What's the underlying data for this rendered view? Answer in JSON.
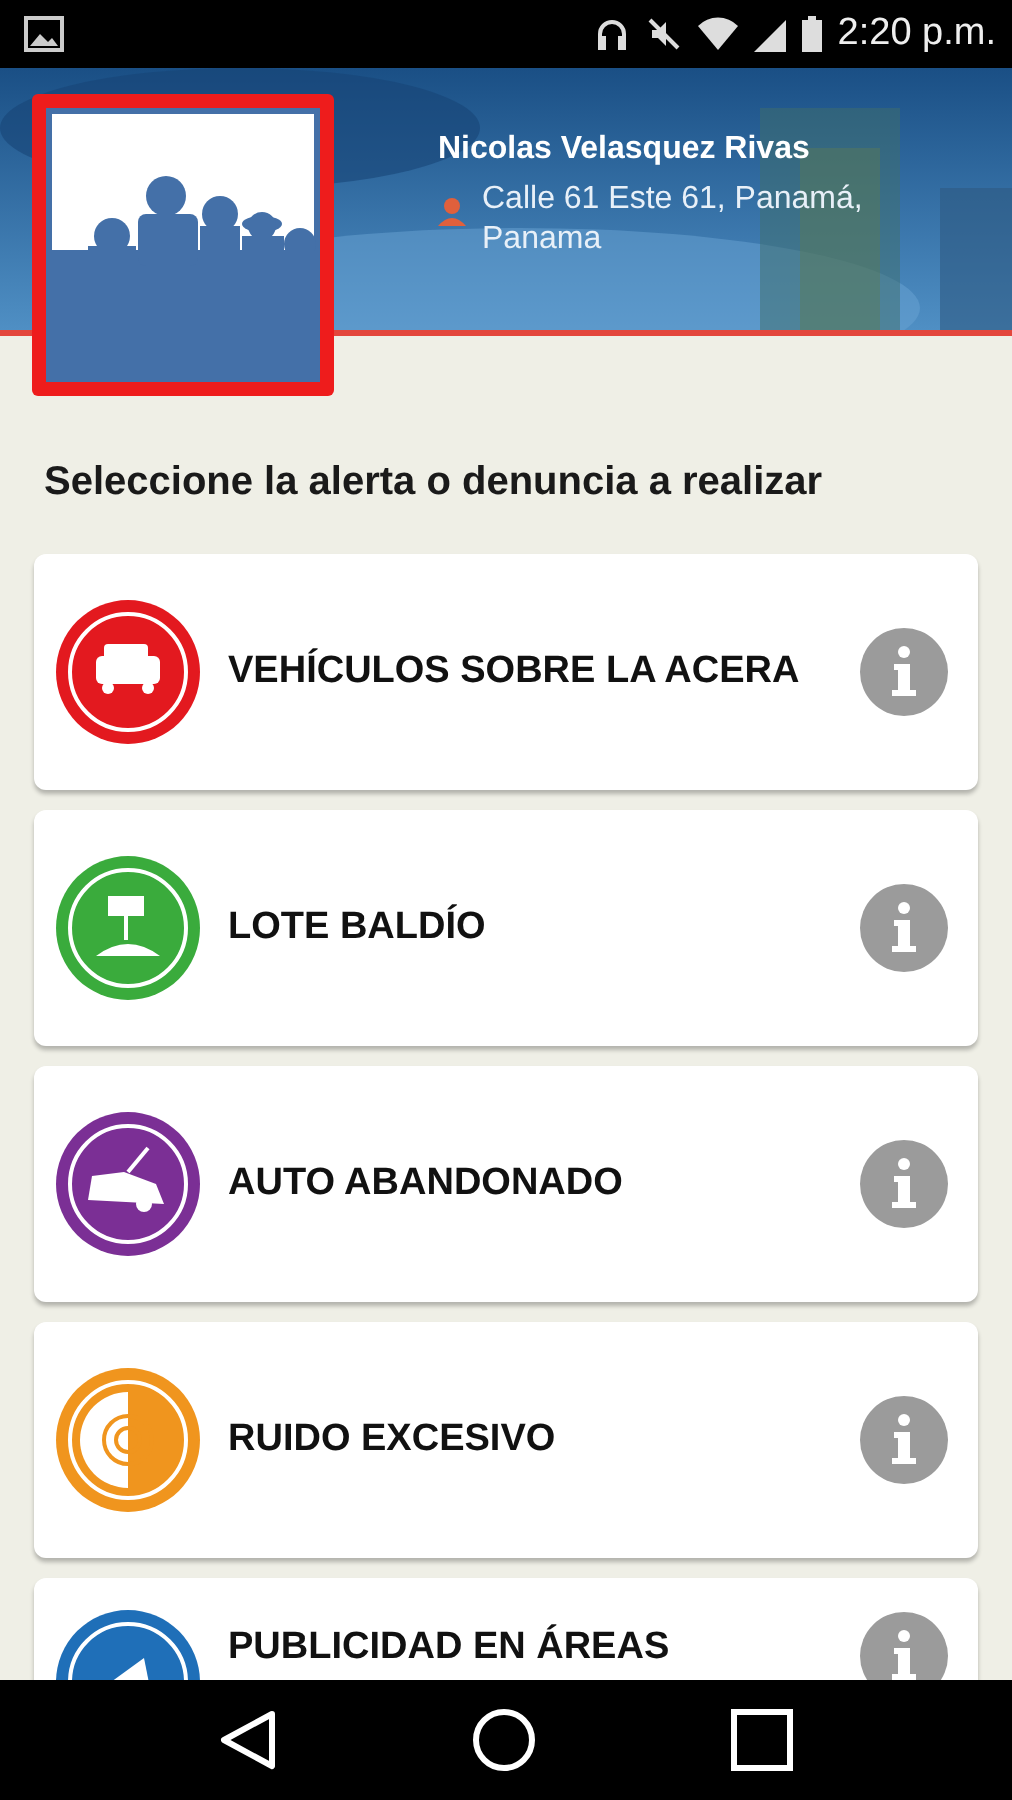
{
  "status_bar": {
    "time": "2:20 p.m."
  },
  "profile": {
    "name": "Nicolas Velasquez Rivas",
    "address": "Calle 61 Este 61, Panamá, Panama"
  },
  "heading": "Seleccione la alerta o denuncia a realizar",
  "alerts": [
    {
      "label": "VEHÍCULOS SOBRE LA ACERA",
      "kind": "car",
      "color": "#e3191f"
    },
    {
      "label": "LOTE BALDÍO",
      "kind": "lot",
      "color": "#3aab3c"
    },
    {
      "label": "AUTO ABANDONADO",
      "kind": "abandoned",
      "color": "#7b2f95"
    },
    {
      "label": "RUIDO EXCESIVO",
      "kind": "noise",
      "color": "#f0951e"
    },
    {
      "label": "PUBLICIDAD EN ÁREAS",
      "kind": "ads",
      "color": "#1f6fb8"
    }
  ]
}
